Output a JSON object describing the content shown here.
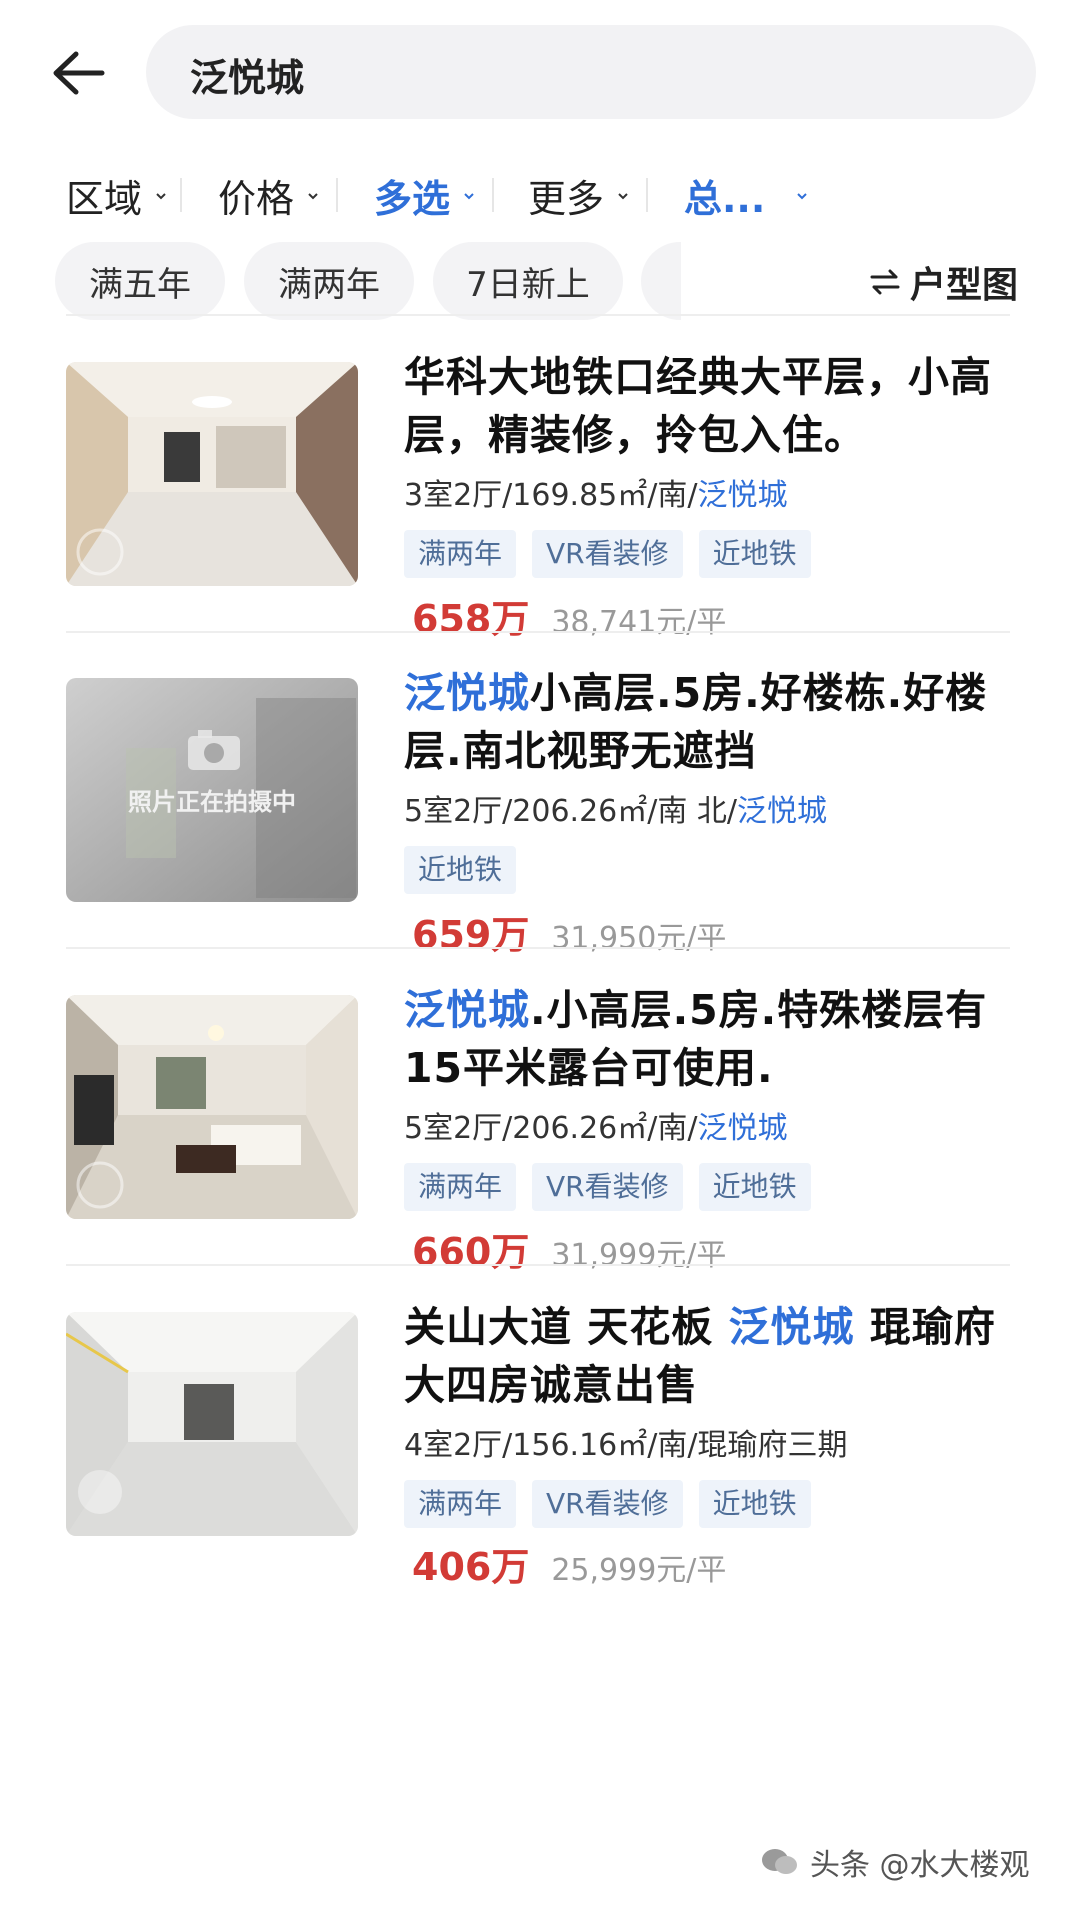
{
  "search": {
    "query": "泛悦城"
  },
  "filters": [
    {
      "label": "区域",
      "active": false
    },
    {
      "label": "价格",
      "active": false
    },
    {
      "label": "多选",
      "active": true
    },
    {
      "label": "更多",
      "active": false
    },
    {
      "label": "总...",
      "active": true
    }
  ],
  "chips": [
    "满五年",
    "满两年",
    "7日新上"
  ],
  "floorplan_label": "户型图",
  "partial_row": "…",
  "listings": [
    {
      "title_pre": "",
      "title_hl": "",
      "title_post": "华科大地铁口经典大平层，小高层，精装修，拎包入住。",
      "specs": "3室2厅/169.85㎡/南/",
      "specs_hl": "泛悦城",
      "tags": [
        "满两年",
        "VR看装修",
        "近地铁"
      ],
      "price": "658万",
      "unit_price": "38,741元/平",
      "thumb": "room"
    },
    {
      "title_pre": "",
      "title_hl": "泛悦城",
      "title_post": "小高层.5房.好楼栋.好楼层.南北视野无遮挡",
      "specs": "5室2厅/206.26㎡/南 北/",
      "specs_hl": "泛悦城",
      "tags": [
        "近地铁"
      ],
      "price": "659万",
      "unit_price": "31,950元/平",
      "thumb": "placeholder",
      "thumb_text": "照片正在拍摄中"
    },
    {
      "title_pre": "",
      "title_hl": "泛悦城",
      "title_post": ".小高层.5房.特殊楼层有15平米露台可使用.",
      "specs": "5室2厅/206.26㎡/南/",
      "specs_hl": "泛悦城",
      "tags": [
        "满两年",
        "VR看装修",
        "近地铁"
      ],
      "price": "660万",
      "unit_price": "31,999元/平",
      "thumb": "living"
    },
    {
      "title_pre": "关山大道 天花板 ",
      "title_hl": "泛悦城",
      "title_post": " 琨瑜府 大四房诚意出售",
      "specs": "4室2厅/156.16㎡/南/琨瑜府三期",
      "specs_hl": "",
      "tags": [
        "满两年",
        "VR看装修",
        "近地铁"
      ],
      "price": "406万",
      "unit_price": "25,999元/平",
      "thumb": "empty"
    }
  ],
  "watermark": "头条 @水大楼观",
  "colors": {
    "accent": "#2f6fd8",
    "price": "#d23b36",
    "tag_bg": "#eef3fa"
  }
}
